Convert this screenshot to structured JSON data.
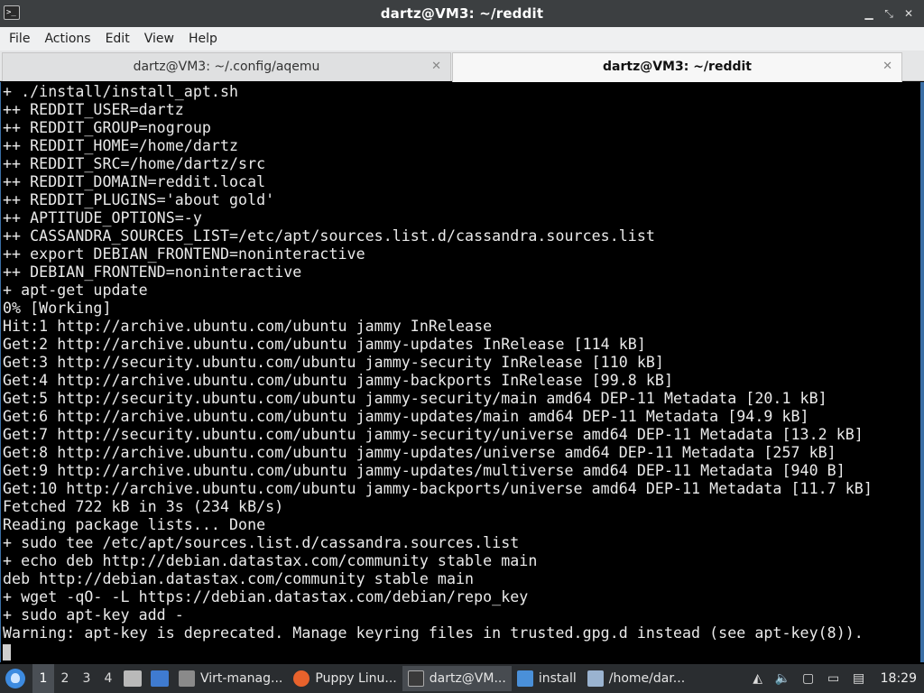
{
  "window": {
    "title": "dartz@VM3: ~/reddit"
  },
  "menu": [
    "File",
    "Actions",
    "Edit",
    "View",
    "Help"
  ],
  "tabs": [
    {
      "label": "dartz@VM3: ~/.config/aqemu",
      "active": false
    },
    {
      "label": "dartz@VM3: ~/reddit",
      "active": true
    }
  ],
  "terminal": {
    "lines": [
      "+ ./install/install_apt.sh",
      "++ REDDIT_USER=dartz",
      "++ REDDIT_GROUP=nogroup",
      "++ REDDIT_HOME=/home/dartz",
      "++ REDDIT_SRC=/home/dartz/src",
      "++ REDDIT_DOMAIN=reddit.local",
      "++ REDDIT_PLUGINS='about gold'",
      "++ APTITUDE_OPTIONS=-y",
      "++ CASSANDRA_SOURCES_LIST=/etc/apt/sources.list.d/cassandra.sources.list",
      "++ export DEBIAN_FRONTEND=noninteractive",
      "++ DEBIAN_FRONTEND=noninteractive",
      "+ apt-get update",
      "0% [Working]",
      "Hit:1 http://archive.ubuntu.com/ubuntu jammy InRelease",
      "Get:2 http://archive.ubuntu.com/ubuntu jammy-updates InRelease [114 kB]",
      "Get:3 http://security.ubuntu.com/ubuntu jammy-security InRelease [110 kB]",
      "Get:4 http://archive.ubuntu.com/ubuntu jammy-backports InRelease [99.8 kB]",
      "Get:5 http://security.ubuntu.com/ubuntu jammy-security/main amd64 DEP-11 Metadata [20.1 kB]",
      "Get:6 http://archive.ubuntu.com/ubuntu jammy-updates/main amd64 DEP-11 Metadata [94.9 kB]",
      "Get:7 http://security.ubuntu.com/ubuntu jammy-security/universe amd64 DEP-11 Metadata [13.2 kB]",
      "Get:8 http://archive.ubuntu.com/ubuntu jammy-updates/universe amd64 DEP-11 Metadata [257 kB]",
      "Get:9 http://archive.ubuntu.com/ubuntu jammy-updates/multiverse amd64 DEP-11 Metadata [940 B]",
      "Get:10 http://archive.ubuntu.com/ubuntu jammy-backports/universe amd64 DEP-11 Metadata [11.7 kB]",
      "Fetched 722 kB in 3s (234 kB/s)",
      "Reading package lists... Done",
      "+ sudo tee /etc/apt/sources.list.d/cassandra.sources.list",
      "+ echo deb http://debian.datastax.com/community stable main",
      "deb http://debian.datastax.com/community stable main",
      "+ wget -qO- -L https://debian.datastax.com/debian/repo_key",
      "+ sudo apt-key add -",
      "Warning: apt-key is deprecated. Manage keyring files in trusted.gpg.d instead (see apt-key(8))."
    ]
  },
  "taskbar": {
    "workspaces": [
      "1",
      "2",
      "3",
      "4"
    ],
    "active_workspace": "1",
    "tasks": [
      {
        "label": "Virt-manag...",
        "icon": "virt-manager-icon",
        "color": "#8a8a8a"
      },
      {
        "label": "Puppy Linu...",
        "icon": "firefox-icon",
        "color": "#e8622c"
      },
      {
        "label": "dartz@VM...",
        "icon": "terminal-icon",
        "color": "#3a3a3a"
      },
      {
        "label": "install",
        "icon": "folder-icon",
        "color": "#4a90d9"
      },
      {
        "label": "/home/dar...",
        "icon": "text-editor-icon",
        "color": "#9ab3d0"
      }
    ],
    "clock": "18:29"
  }
}
